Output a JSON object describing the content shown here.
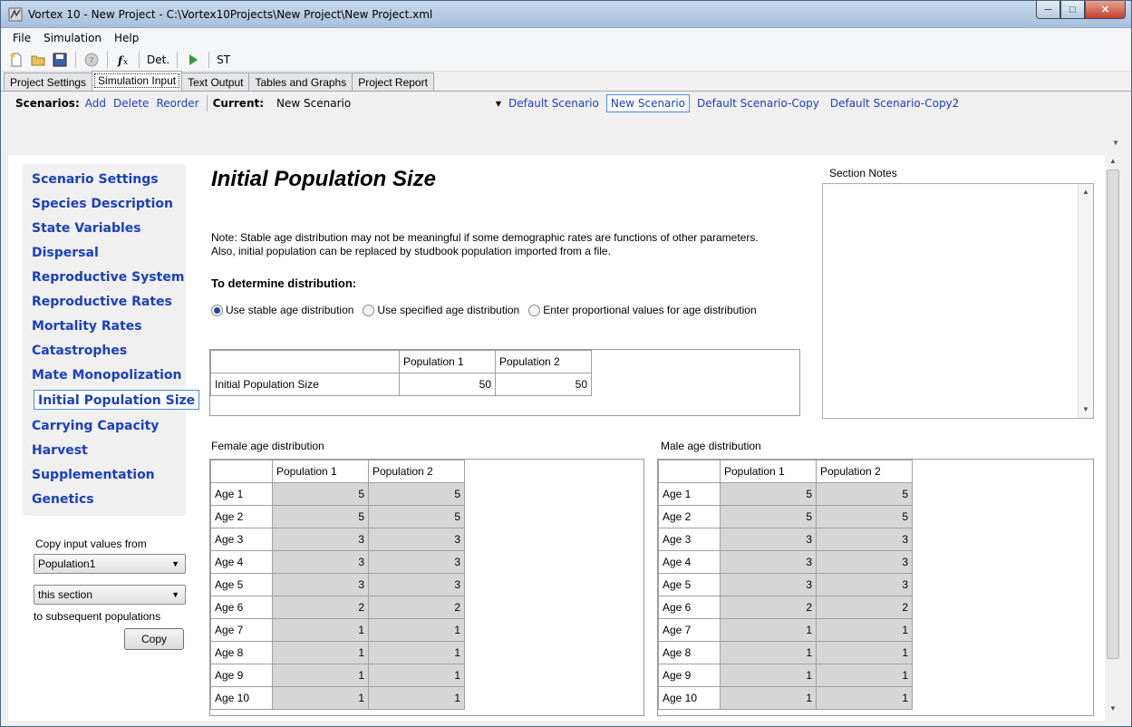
{
  "window": {
    "title": "Vortex 10 - New Project - C:\\Vortex10Projects\\New Project\\New Project.xml"
  },
  "menu": [
    "File",
    "Simulation",
    "Help"
  ],
  "toolbar": {
    "det_label": "Det.",
    "st_label": "ST"
  },
  "tabs": [
    "Project Settings",
    "Simulation Input",
    "Text Output",
    "Tables and Graphs",
    "Project Report"
  ],
  "scenarios": {
    "label": "Scenarios:",
    "add": "Add",
    "delete": "Delete",
    "reorder": "Reorder",
    "current_label": "Current:",
    "current_value": "New Scenario",
    "list": [
      "Default Scenario",
      "New Scenario",
      "Default Scenario-Copy",
      "Default Scenario-Copy2"
    ]
  },
  "nav": [
    "Scenario Settings",
    "Species Description",
    "State Variables",
    "Dispersal",
    "Reproductive System",
    "Reproductive Rates",
    "Mortality Rates",
    "Catastrophes",
    "Mate Monopolization",
    "Initial Population Size",
    "Carrying Capacity",
    "Harvest",
    "Supplementation",
    "Genetics"
  ],
  "copy": {
    "label": "Copy input values from",
    "population": "Population1",
    "section": "this section",
    "to_label": "to subsequent populations",
    "button": "Copy"
  },
  "main": {
    "heading": "Initial Population Size",
    "note_line1": "Note: Stable age distribution may not be meaningful if some demographic rates are functions of other parameters.",
    "note_line2": "Also, initial population can be replaced by studbook population imported from a file.",
    "dist_label": "To determine distribution:",
    "radio_stable": "Use stable age distribution",
    "radio_specified": "Use specified age distribution",
    "radio_proportional": "Enter proportional values for age distribution"
  },
  "init_table": {
    "headers": [
      "",
      "Population 1",
      "Population 2"
    ],
    "row_label": "Initial Population Size",
    "values": [
      "50",
      "50"
    ]
  },
  "female": {
    "label": "Female age distribution",
    "headers": [
      "",
      "Population 1",
      "Population 2"
    ],
    "rows": [
      [
        "Age 1",
        "5",
        "5"
      ],
      [
        "Age 2",
        "5",
        "5"
      ],
      [
        "Age 3",
        "3",
        "3"
      ],
      [
        "Age 4",
        "3",
        "3"
      ],
      [
        "Age 5",
        "3",
        "3"
      ],
      [
        "Age 6",
        "2",
        "2"
      ],
      [
        "Age 7",
        "1",
        "1"
      ],
      [
        "Age 8",
        "1",
        "1"
      ],
      [
        "Age 9",
        "1",
        "1"
      ],
      [
        "Age 10",
        "1",
        "1"
      ]
    ]
  },
  "male": {
    "label": "Male age distribution",
    "headers": [
      "",
      "Population 1",
      "Population 2"
    ],
    "rows": [
      [
        "Age 1",
        "5",
        "5"
      ],
      [
        "Age 2",
        "5",
        "5"
      ],
      [
        "Age 3",
        "3",
        "3"
      ],
      [
        "Age 4",
        "3",
        "3"
      ],
      [
        "Age 5",
        "3",
        "3"
      ],
      [
        "Age 6",
        "2",
        "2"
      ],
      [
        "Age 7",
        "1",
        "1"
      ],
      [
        "Age 8",
        "1",
        "1"
      ],
      [
        "Age 9",
        "1",
        "1"
      ],
      [
        "Age 10",
        "1",
        "1"
      ]
    ]
  },
  "section_notes": {
    "title": "Section Notes"
  }
}
